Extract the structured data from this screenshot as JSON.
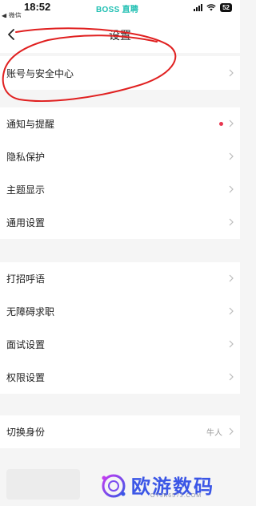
{
  "status_bar": {
    "time": "18:52",
    "carrier_app": "BOSS 直聘",
    "back_to_app": "◀ 微信",
    "battery": "52"
  },
  "header": {
    "title": "设置"
  },
  "groups": [
    {
      "items": [
        {
          "label": "账号与安全中心"
        }
      ]
    },
    {
      "items": [
        {
          "label": "通知与提醒",
          "badge": "red-dot"
        },
        {
          "label": "隐私保护"
        },
        {
          "label": "主题显示"
        },
        {
          "label": "通用设置"
        }
      ]
    },
    {
      "items": [
        {
          "label": "打招呼语"
        },
        {
          "label": "无障碍求职"
        },
        {
          "label": "面试设置"
        },
        {
          "label": "权限设置"
        }
      ]
    },
    {
      "items": [
        {
          "label": "切换身份",
          "value": "牛人"
        }
      ]
    }
  ],
  "watermark": {
    "text": "欧游数码",
    "url": "OYJK6572.COM"
  },
  "colors": {
    "accent_dot": "#e8364f",
    "annotation": "#e02020",
    "carrier": "#1fbfb2",
    "watermark": "#3b56e6"
  },
  "icons": [
    "back-icon",
    "chevron-right-icon",
    "signal-icon",
    "wifi-icon",
    "battery-icon",
    "watermark-logo-icon"
  ]
}
